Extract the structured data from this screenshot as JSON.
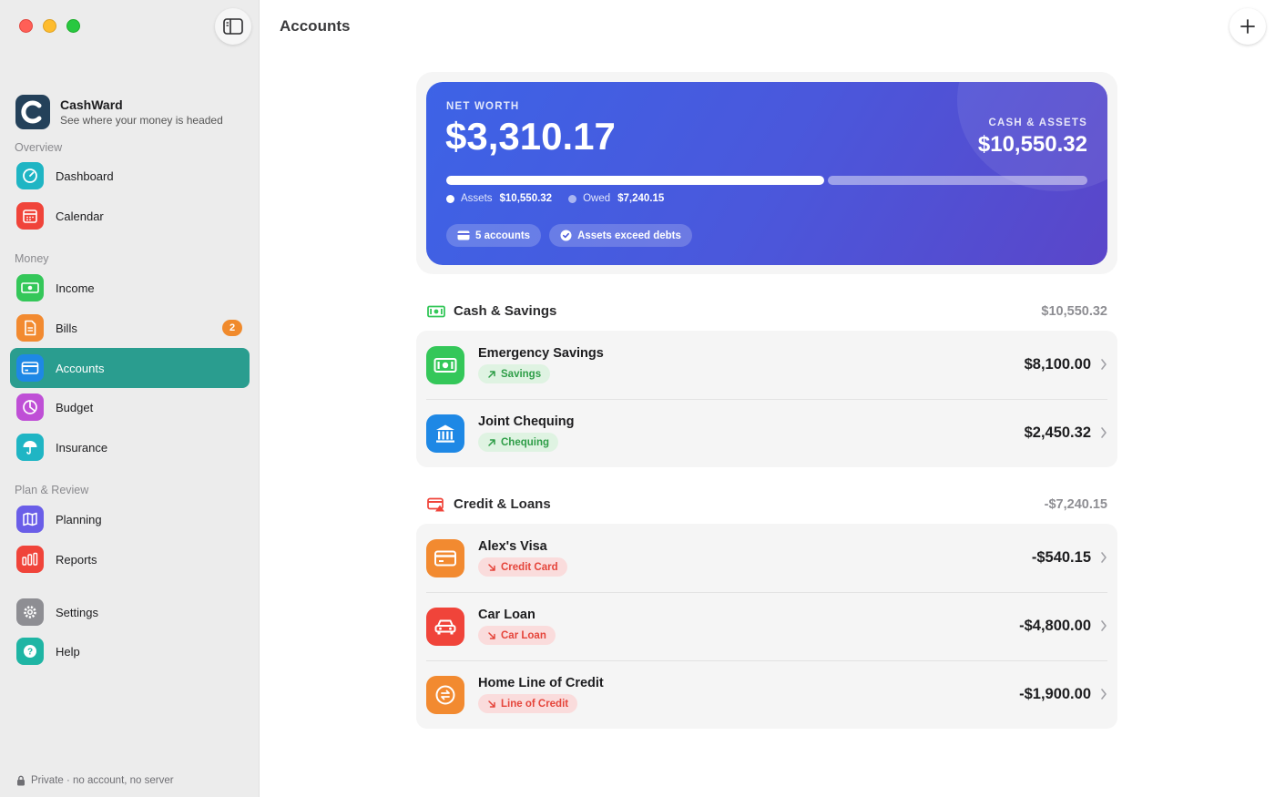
{
  "app": {
    "name": "CashWard",
    "tagline": "See where your money is headed"
  },
  "header": {
    "title": "Accounts"
  },
  "sidebar": {
    "sections": {
      "overview": "Overview",
      "money": "Money",
      "plan": "Plan & Review"
    },
    "items": [
      {
        "label": "Dashboard",
        "icon": "gauge-icon",
        "color": "#1fb5c4"
      },
      {
        "label": "Calendar",
        "icon": "calendar-icon",
        "color": "#f0443a"
      },
      {
        "label": "Income",
        "icon": "banknote-icon",
        "color": "#34c759"
      },
      {
        "label": "Bills",
        "icon": "document-icon",
        "color": "#f28a30",
        "badge": "2"
      },
      {
        "label": "Accounts",
        "icon": "card-icon",
        "color": "#1e88e5",
        "active": true
      },
      {
        "label": "Budget",
        "icon": "pie-icon",
        "color": "#bf4fd6"
      },
      {
        "label": "Insurance",
        "icon": "umbrella-icon",
        "color": "#1fb5c4"
      },
      {
        "label": "Planning",
        "icon": "map-icon",
        "color": "#6a5ee8"
      },
      {
        "label": "Reports",
        "icon": "bars-icon",
        "color": "#f0443a"
      },
      {
        "label": "Settings",
        "icon": "gear-icon",
        "color": "#8e8e93"
      },
      {
        "label": "Help",
        "icon": "question-icon",
        "color": "#1fb5a4"
      }
    ],
    "privacy": "Private · no account, no server"
  },
  "summary": {
    "net_worth_label": "NET WORTH",
    "net_worth": "$3,310.17",
    "assets_label_caps": "CASH & ASSETS",
    "assets_total": "$10,550.32",
    "assets_fraction": 0.593,
    "legend_assets_label": "Assets",
    "legend_assets_value": "$10,550.32",
    "legend_owed_label": "Owed",
    "legend_owed_value": "$7,240.15",
    "chip_accounts": "5 accounts",
    "chip_status": "Assets exceed debts"
  },
  "groups": {
    "cash": {
      "title": "Cash & Savings",
      "total": "$10,550.32",
      "accounts": [
        {
          "name": "Emergency Savings",
          "tag": "Savings",
          "amount": "$8,100.00",
          "icon": "banknote-icon",
          "color": "#34c759"
        },
        {
          "name": "Joint Chequing",
          "tag": "Chequing",
          "amount": "$2,450.32",
          "icon": "bank-icon",
          "color": "#1e88e5"
        }
      ]
    },
    "credit": {
      "title": "Credit & Loans",
      "total": "-$7,240.15",
      "accounts": [
        {
          "name": "Alex's Visa",
          "tag": "Credit Card",
          "amount": "-$540.15",
          "icon": "card-icon",
          "color": "#f28a30"
        },
        {
          "name": "Car Loan",
          "tag": "Car Loan",
          "amount": "-$4,800.00",
          "icon": "car-icon",
          "color": "#f0443a"
        },
        {
          "name": "Home Line of Credit",
          "tag": "Line of Credit",
          "amount": "-$1,900.00",
          "icon": "exchange-icon",
          "color": "#f28a30"
        }
      ]
    }
  }
}
